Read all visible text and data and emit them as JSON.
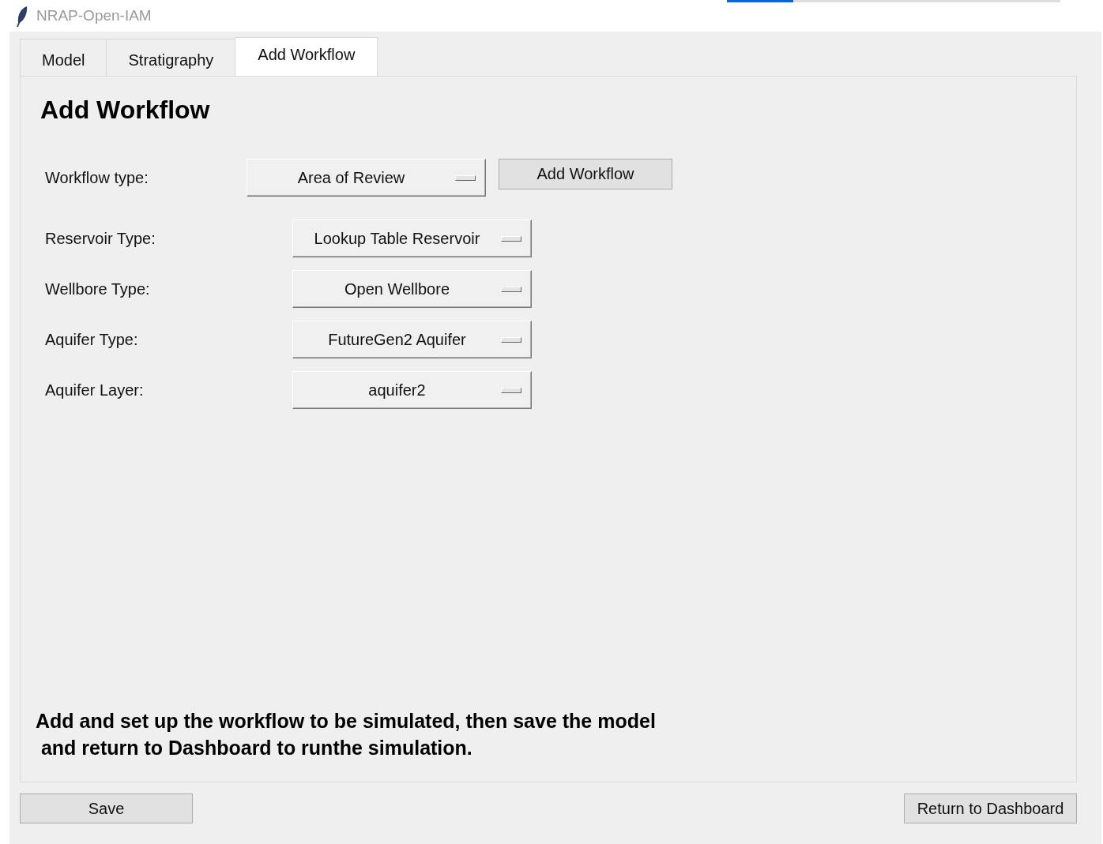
{
  "window": {
    "title": "NRAP-Open-IAM"
  },
  "progress": {
    "level": 0.2
  },
  "tabs": [
    {
      "label": "Model",
      "selected": false
    },
    {
      "label": "Stratigraphy",
      "selected": false
    },
    {
      "label": "Add Workflow",
      "selected": true
    }
  ],
  "heading": "Add Workflow",
  "workflow": {
    "label": "Workflow type:",
    "value": "Area of Review",
    "button": "Add Workflow"
  },
  "fields": [
    {
      "label": "Reservoir Type:",
      "value": "Lookup Table Reservoir"
    },
    {
      "label": "Wellbore Type:",
      "value": "Open Wellbore"
    },
    {
      "label": "Aquifer Type:",
      "value": "FutureGen2 Aquifer"
    },
    {
      "label": "Aquifer Layer:",
      "value": "aquifer2"
    }
  ],
  "instructions": [
    "Add and set up the workflow to be simulated, then save the model",
    " and return to Dashboard to runthe simulation."
  ],
  "buttons": {
    "save": "Save",
    "return": "Return to Dashboard"
  }
}
